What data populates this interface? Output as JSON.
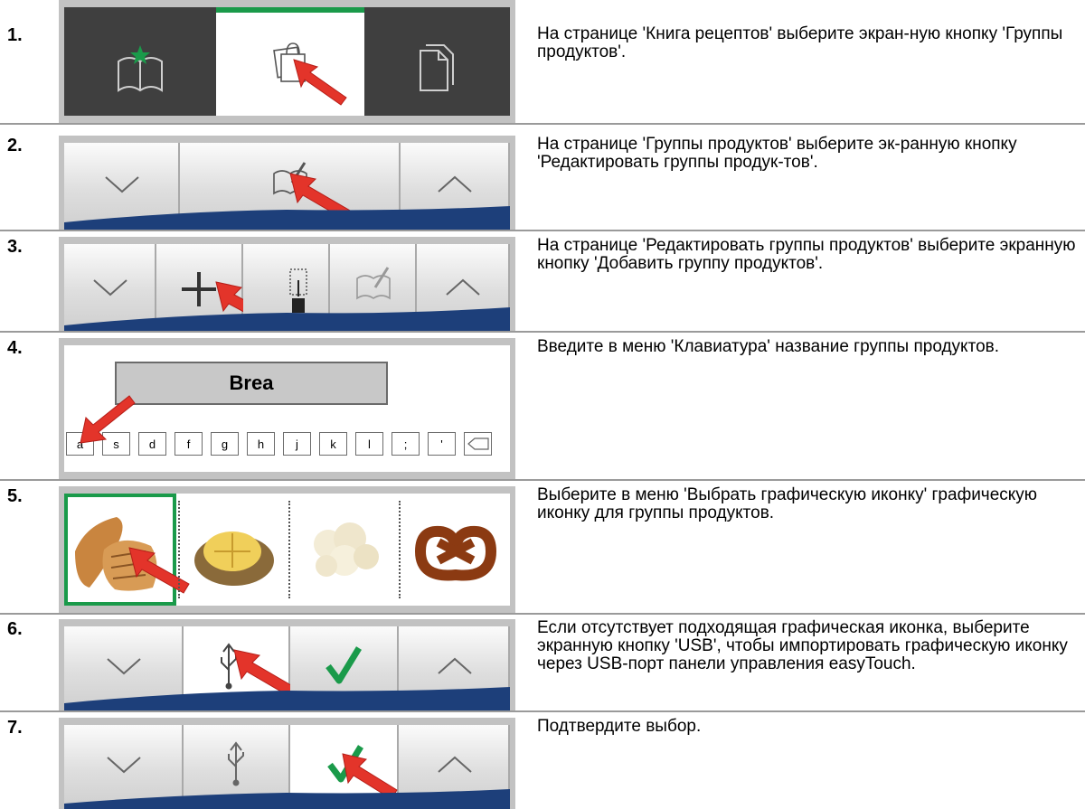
{
  "steps": [
    {
      "num": "1.",
      "text": "На странице 'Книга рецептов' выберите экран-ную кнопку 'Группы продуктов'."
    },
    {
      "num": "2.",
      "text": "На странице 'Группы продуктов' выберите эк-ранную кнопку 'Редактировать группы продук-тов'."
    },
    {
      "num": "3.",
      "text": "На странице 'Редактировать группы продуктов' выберите экранную кнопку 'Добавить группу продуктов'."
    },
    {
      "num": "4.",
      "text": "Введите в меню 'Клавиатура' название группы продуктов."
    },
    {
      "num": "5.",
      "text": "Выберите в меню 'Выбрать графическую иконку' графическую иконку для группы продуктов."
    },
    {
      "num": "6.",
      "text": "Если отсутствует подходящая графическая иконка, выберите экранную кнопку 'USB', чтобы импортировать графическую иконку через USB-порт панели управления easyTouch."
    },
    {
      "num": "7.",
      "text": "Подтвердите выбор."
    }
  ],
  "keyboard": {
    "field_value": "Brea",
    "keys": [
      "a",
      "s",
      "d",
      "f",
      "g",
      "h",
      "j",
      "k",
      "l",
      ";",
      "'"
    ]
  },
  "icons": [
    "recipe-book-icon",
    "product-groups-icon",
    "pages-icon",
    "chevron-down-icon",
    "edit-book-icon",
    "chevron-up-icon",
    "plus-icon",
    "import-icon",
    "usb-icon",
    "checkmark-icon",
    "backspace-icon",
    "red-arrow-icon"
  ],
  "colors": {
    "accent_green": "#1a9a4a",
    "arrow_red": "#e3342a",
    "band_blue": "#1d3f7a",
    "dark_tile": "#3f3f3f",
    "panel_gray": "#c2c2c2"
  }
}
